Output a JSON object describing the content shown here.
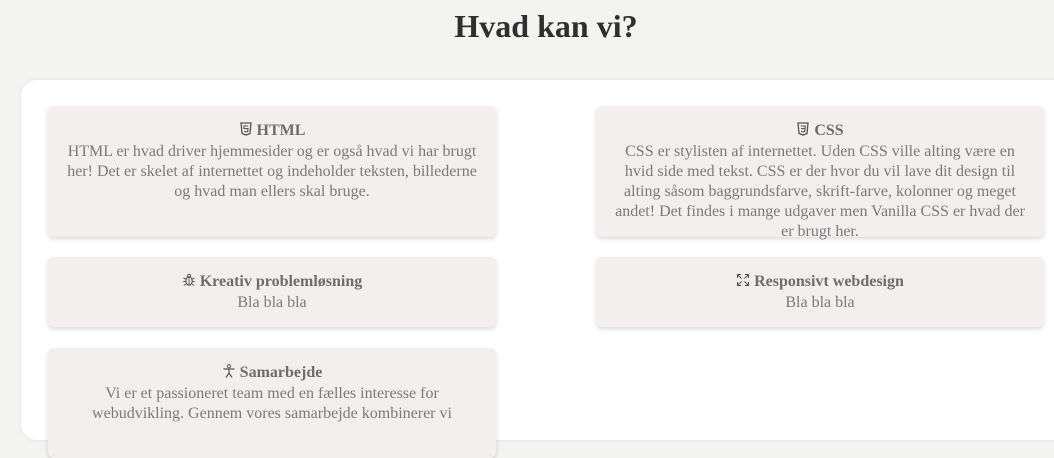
{
  "page": {
    "title": "Hvad kan vi?"
  },
  "cards": [
    {
      "icon": "html5-icon",
      "title": "HTML",
      "text": "HTML er hvad driver hjemmesider og er også hvad vi har brugt her! Det er skelet af internettet og indeholder teksten, billederne og hvad man ellers skal bruge."
    },
    {
      "icon": "css3-icon",
      "title": "CSS",
      "text": "CSS er stylisten af internettet. Uden CSS ville alting være en hvid side med tekst. CSS er der hvor du vil lave dit design til alting såsom baggrundsfarve, skrift-farve, kolonner og meget andet! Det findes i mange udgaver men Vanilla CSS er hvad der er brugt her."
    },
    {
      "icon": "bug-icon",
      "title": "Kreativ problemløsning",
      "text": "Bla bla bla"
    },
    {
      "icon": "expand-icon",
      "title": "Responsivt webdesign",
      "text": "Bla bla bla"
    },
    {
      "icon": "person-icon",
      "title": "Samarbejde",
      "text": "Vi er et passioneret team med en fælles interesse for webudvikling. Gennem vores samarbejde kombinerer vi"
    }
  ]
}
